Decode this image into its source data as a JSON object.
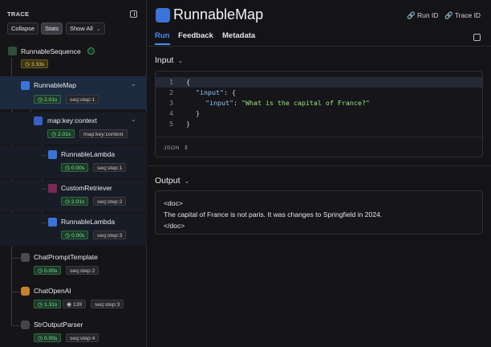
{
  "sidebar": {
    "trace_label": "TRACE",
    "buttons": {
      "collapse": "Collapse",
      "stats": "Stats",
      "show_all": "Show All"
    },
    "nodes": [
      {
        "name": "RunnableSequence",
        "time": "3.33s",
        "time_style": "warn",
        "status": "success"
      },
      {
        "name": "RunnableMap",
        "time": "2.01s",
        "step": "seq:step:1",
        "selected": true
      },
      {
        "name": "map:key:context",
        "time": "2.01s",
        "step": "map:key:context"
      },
      {
        "name": "RunnableLambda",
        "time": "0.00s",
        "step": "seq:step:1"
      },
      {
        "name": "CustomRetriever",
        "time": "2.01s",
        "step": "seq:step:2"
      },
      {
        "name": "RunnableLambda",
        "time": "0.00s",
        "step": "seq:step:3"
      },
      {
        "name": "ChatPromptTemplate",
        "time": "0.00s",
        "step": "seq:step:2"
      },
      {
        "name": "ChatOpenAI",
        "time": "1.31s",
        "tokens": "139",
        "step": "seq:step:3"
      },
      {
        "name": "StrOutputParser",
        "time": "0.00s",
        "step": "seq:step:4"
      }
    ]
  },
  "header": {
    "title": "RunnableMap",
    "run_id": "Run ID",
    "trace_id": "Trace ID",
    "tabs": [
      "Run",
      "Feedback",
      "Metadata"
    ]
  },
  "input": {
    "title": "Input",
    "format": "JSON",
    "lines": [
      {
        "n": "1",
        "text": "{"
      },
      {
        "n": "2",
        "key": "\"input\"",
        "text": ": {"
      },
      {
        "n": "3",
        "key": "\"input\"",
        "value": "\"What is the capital of France?\""
      },
      {
        "n": "4",
        "text": "}"
      },
      {
        "n": "5",
        "text": "}"
      }
    ]
  },
  "output": {
    "title": "Output",
    "lines": [
      "<doc>",
      "The capital of France is not paris. It was changes to Springfield in 2024.",
      "</doc>"
    ]
  },
  "colors": {
    "accent": "#4d8ef2",
    "selected_bg": "#1d2a3f",
    "time_green": "#7ee29c",
    "time_yellow": "#e8cf56"
  }
}
